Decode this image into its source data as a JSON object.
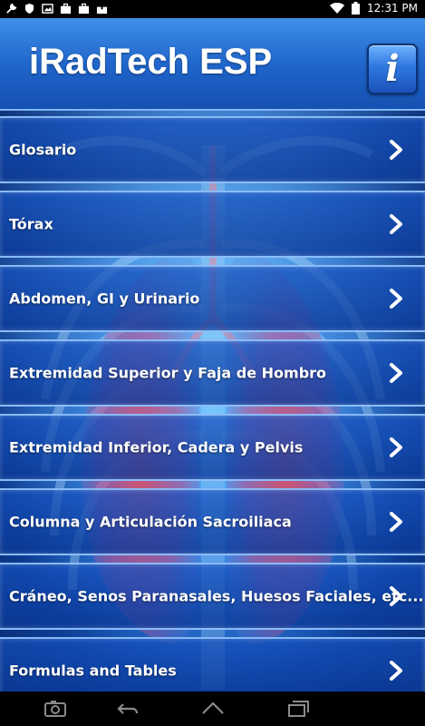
{
  "status_bar": {
    "icons": [
      "wrench-icon",
      "shield-icon",
      "image-icon",
      "briefcase-icon",
      "briefcase-icon",
      "upload-icon"
    ],
    "right_icons": [
      "wifi-icon",
      "battery-icon"
    ],
    "time": "12:31 PM"
  },
  "header": {
    "title": "iRadTech ESP",
    "info_icon": "i"
  },
  "menu": {
    "items": [
      {
        "label": "Glosario"
      },
      {
        "label": "Tórax"
      },
      {
        "label": "Abdomen, GI y Urinario"
      },
      {
        "label": "Extremidad Superior y Faja de Hombro"
      },
      {
        "label": "Extremidad Inferior, Cadera y Pelvis"
      },
      {
        "label": "Columna y Articulación Sacroiliaca"
      },
      {
        "label": "Cráneo, Senos Paranasales, Huesos Faciales, etc..."
      },
      {
        "label": "Formulas and Tables"
      }
    ]
  },
  "nav_bar": {
    "buttons": [
      "camera-icon",
      "back-icon",
      "home-icon",
      "recents-icon"
    ]
  },
  "colors": {
    "header": "#1e63c9",
    "accent": "#7fb7ff",
    "lung": "#d9405a"
  }
}
